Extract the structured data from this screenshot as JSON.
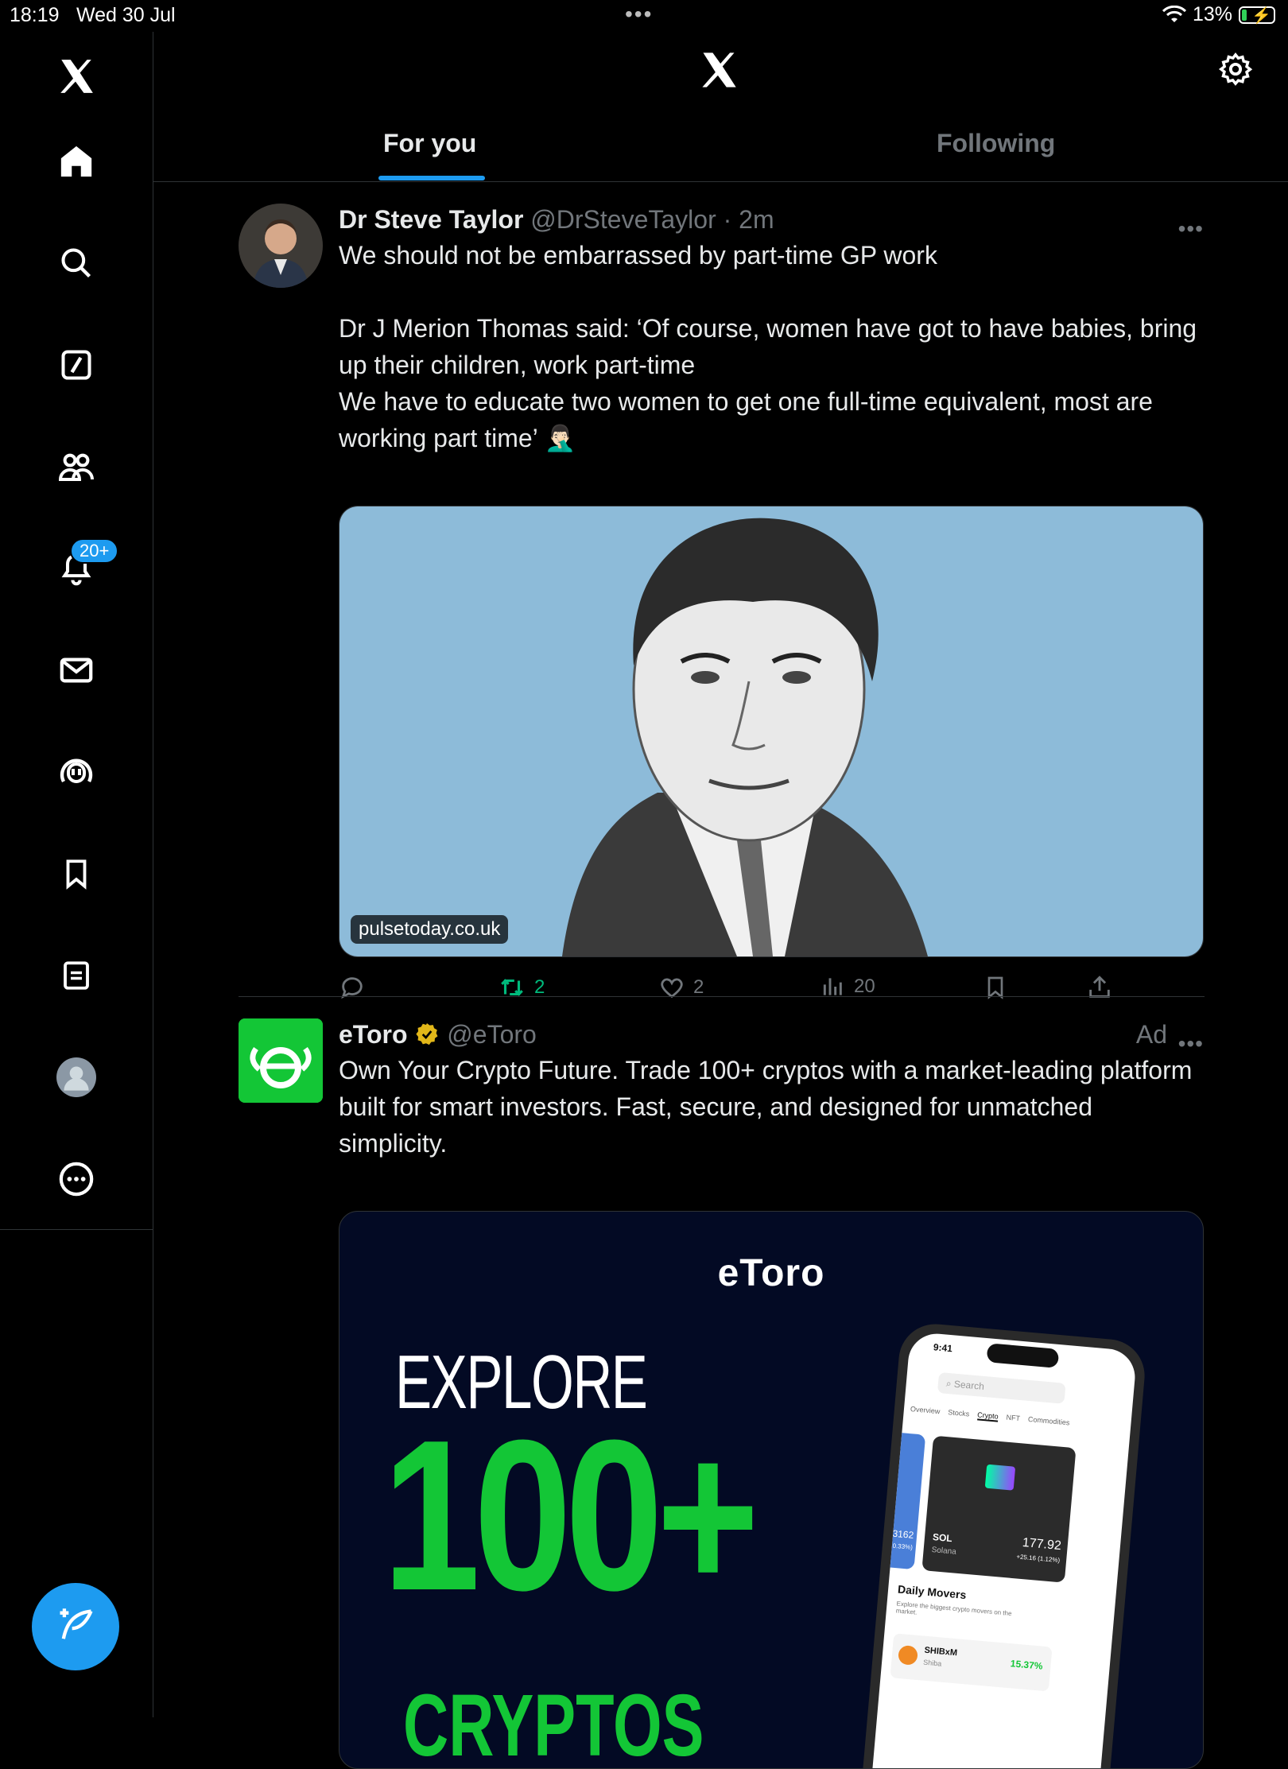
{
  "status_bar": {
    "time": "18:19",
    "date": "Wed 30 Jul",
    "battery": "13%"
  },
  "sidebar": {
    "notifications_badge": "20+"
  },
  "header": {
    "tabs": [
      {
        "label": "For you",
        "active": true
      },
      {
        "label": "Following",
        "active": false
      }
    ]
  },
  "tweets": [
    {
      "name": "Dr Steve Taylor",
      "handle": "@DrSteveTaylor",
      "time": "· 2m",
      "text": "We should not be embarrassed by part-time GP work\n\nDr J Merion Thomas said: ‘Of course, women have got to have babies, bring up their children, work part-time\nWe have to educate two women to get one full-time equivalent, most are working part time’ 🤦🏻‍♂️",
      "media_source": "pulsetoday.co.uk",
      "retweets": "2",
      "likes": "2",
      "views": "20"
    },
    {
      "name": "eToro",
      "handle": "@eToro",
      "ad_label": "Ad",
      "text": "Own Your Crypto Future. Trade 100+ cryptos with a market-leading platform built for smart investors. Fast, secure, and designed for unmatched simplicity.",
      "ad_creative": {
        "brand": "eToro",
        "headline_1": "EXPLORE",
        "headline_2": "100+",
        "headline_3": "CRYPTOS",
        "phone": {
          "time": "9:41",
          "search": "Search",
          "tabs": [
            "Overview",
            "Stocks",
            "Crypto",
            "NFT",
            "Commodities"
          ],
          "card_left_value": "3162",
          "card_left_change": "0.33%)",
          "card_symbol": "SOL",
          "card_name": "Solana",
          "card_price": "177.92",
          "card_change": "+25.16 (1.12%)",
          "movers_title": "Daily Movers",
          "movers_sub": "Explore the biggest crypto movers on the market.",
          "mover_symbol": "SHIBxM",
          "mover_name": "Shiba",
          "mover_change": "15.37%"
        }
      }
    }
  ],
  "colors": {
    "accent": "#1d9bf0",
    "retweet": "#00ba7c",
    "etoro_green": "#13c636",
    "background": "#000000"
  }
}
